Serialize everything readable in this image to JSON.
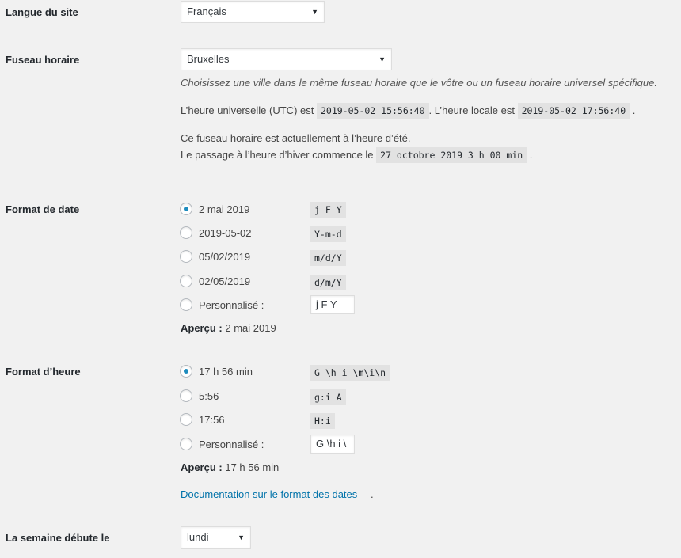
{
  "language": {
    "label": "Langue du site",
    "value": "Français"
  },
  "timezone": {
    "label": "Fuseau horaire",
    "value": "Bruxelles",
    "description": "Choisissez une ville dans le même fuseau horaire que le vôtre ou un fuseau horaire universel spécifique.",
    "utc_prefix": "L’heure universelle (UTC) est",
    "utc_value": "2019-05-02 15:56:40",
    "local_prefix": ". L’heure locale est",
    "local_value": "2019-05-02 17:56:40",
    "local_suffix": ".",
    "dst_line": "Ce fuseau horaire est actuellement à l’heure d’été.",
    "transition_prefix": "Le passage à l’heure d’hiver commence le",
    "transition_value": "27 octobre 2019 3 h 00 min",
    "transition_suffix": "."
  },
  "date_format": {
    "label": "Format de date",
    "options": [
      {
        "label": "2 mai 2019",
        "code": "j F Y",
        "checked": true
      },
      {
        "label": "2019-05-02",
        "code": "Y-m-d",
        "checked": false
      },
      {
        "label": "05/02/2019",
        "code": "m/d/Y",
        "checked": false
      },
      {
        "label": "02/05/2019",
        "code": "d/m/Y",
        "checked": false
      }
    ],
    "custom_label": "Personnalisé :",
    "custom_value": "j F Y",
    "preview_label": "Aperçu :",
    "preview_value": "2 mai 2019"
  },
  "time_format": {
    "label": "Format d’heure",
    "options": [
      {
        "label": "17 h 56 min",
        "code": "G \\h i \\m\\i\\n",
        "checked": true
      },
      {
        "label": "5:56",
        "code": "g:i A",
        "checked": false
      },
      {
        "label": "17:56",
        "code": "H:i",
        "checked": false
      }
    ],
    "custom_label": "Personnalisé :",
    "custom_value": "G \\h i \\",
    "preview_label": "Aperçu :",
    "preview_value": "17 h 56 min",
    "doc_link": "Documentation sur le format des dates",
    "doc_suffix": "."
  },
  "week_start": {
    "label": "La semaine débute le",
    "value": "lundi"
  },
  "colors": {
    "background": "#f1f1f1",
    "link": "#0073aa",
    "radio_checked": "#1e8cbe"
  }
}
